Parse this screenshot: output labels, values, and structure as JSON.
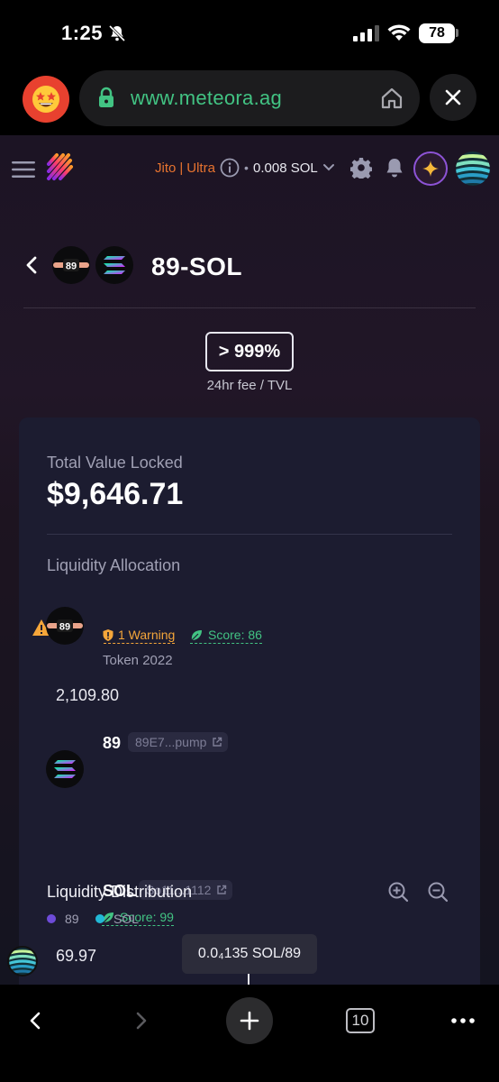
{
  "status_bar": {
    "time": "1:25",
    "battery": "78"
  },
  "browser": {
    "url": "www.meteora.ag",
    "tab_count": "10"
  },
  "header": {
    "jito": "Jito",
    "jito_mode": "Ultra",
    "priority_fee": "0.008 SOL"
  },
  "pair": {
    "title": "89-SOL",
    "token_a_logo_text": "89",
    "fee_tvl_value": "> 999%",
    "fee_tvl_label": "24hr fee / TVL"
  },
  "tvl": {
    "label": "Total Value Locked",
    "value": "$9,646.71"
  },
  "allocation": {
    "label": "Liquidity Allocation",
    "tokens": [
      {
        "name": "89",
        "address": "89E7...pump",
        "warning": "1 Warning",
        "score": "Score: 86",
        "standard": "Token 2022",
        "amount": "2,109.80"
      },
      {
        "name": "SOL",
        "address": "So11...1112",
        "score": "Score: 99",
        "amount": "69.97"
      }
    ]
  },
  "distribution": {
    "label": "Liquidity Distribution",
    "legend": [
      {
        "name": "89",
        "color": "#6e4bd8"
      },
      {
        "name": "SOL",
        "color": "#22b8d6"
      }
    ],
    "price_tooltip": "0.0₄135 SOL/89"
  },
  "colors": {
    "accent_green": "#42c383",
    "warning": "#f5a63a",
    "jito_orange": "#e7732f",
    "card_bg": "#1c1c30"
  }
}
